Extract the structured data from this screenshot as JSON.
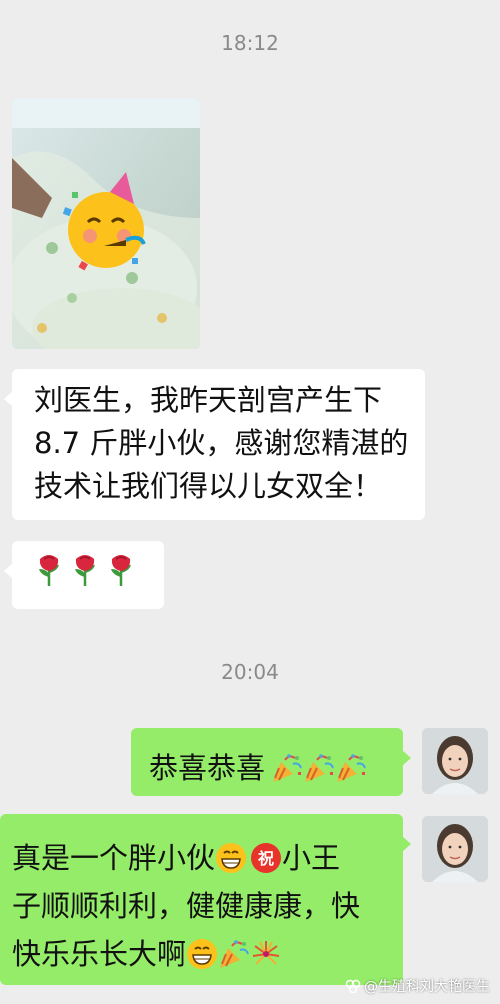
{
  "timestamps": [
    "18:12",
    "20:04"
  ],
  "messages": {
    "received_1": {
      "lines": [
        "刘医生，我昨天剖宫产生下",
        "8.7 斤胖小伙，感谢您精湛的",
        "技术让我们得以儿女双全！"
      ]
    },
    "received_2": {
      "icons": [
        "rose-icon",
        "rose-icon",
        "rose-icon"
      ]
    },
    "sent_1": {
      "text": "恭喜恭喜",
      "icons": [
        "party-popper-icon",
        "party-popper-icon",
        "party-popper-icon"
      ]
    },
    "sent_2": {
      "line1_a": "真是一个胖小伙",
      "line1_b": "小王",
      "line2": "子顺顺利利，健健康康，快",
      "line3": "快乐乐长大啊"
    }
  },
  "photo": {
    "overlay_icon": "partying-face-icon"
  },
  "watermark": {
    "text": "@生殖科刘大艳医生"
  },
  "colors": {
    "background": "#ededed",
    "received_bubble": "#ffffff",
    "sent_bubble": "#95ec69",
    "timestamp": "#8a8a8a"
  }
}
